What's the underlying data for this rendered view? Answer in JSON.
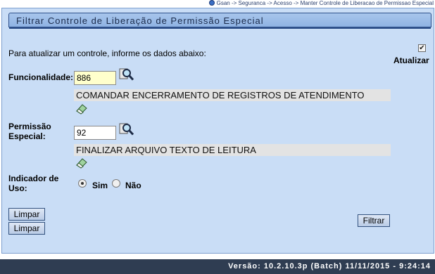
{
  "breadcrumb": {
    "text": "Gsan -> Seguranca -> Acesso -> Manter Controle de Liberacao de Permissao Especial"
  },
  "panel": {
    "title": "Filtrar Controle de Liberação de Permissão Especial"
  },
  "intro": {
    "text": "Para atualizar um controle, informe os dados abaixo:"
  },
  "atualizar": {
    "label": "Atualizar",
    "checked": true,
    "check_glyph": "✔"
  },
  "funcionalidade": {
    "label": "Funcionalidade:",
    "value": "886",
    "description": "COMANDAR ENCERRAMENTO DE REGISTROS DE ATENDIMENTO",
    "search_icon": "search-icon",
    "clear_icon": "eraser-icon"
  },
  "permissao": {
    "label_line1": "Permissão",
    "label_line2": "Especial:",
    "value": "92",
    "description": "FINALIZAR ARQUIVO TEXTO DE LEITURA",
    "search_icon": "search-icon",
    "clear_icon": "eraser-icon"
  },
  "indicador": {
    "label_line1": "Indicador de",
    "label_line2": "Uso:",
    "options": [
      {
        "label": "Sim",
        "checked": true
      },
      {
        "label": "Não",
        "checked": false
      }
    ]
  },
  "buttons": {
    "limpar1": "Limpar",
    "limpar2": "Limpar",
    "filtrar": "Filtrar"
  },
  "footer": {
    "version": "Versão: 10.2.10.3p (Batch) 11/11/2015 - 9:24:14"
  },
  "colors": {
    "panel_bg": "#c9ddf6",
    "title_bar": "#8fb3e3",
    "highlight_input": "#ffffcc",
    "footer_bg": "#2f3d52"
  }
}
